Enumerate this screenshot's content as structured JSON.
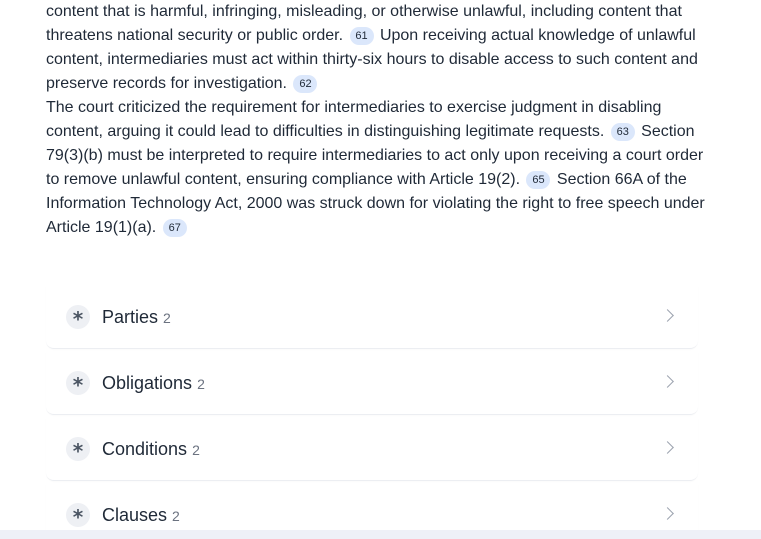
{
  "paragraphs": [
    {
      "segments": [
        {
          "type": "text",
          "value": "content that is harmful, infringing, misleading, or otherwise unlawful, including content that threatens national security or public order. "
        },
        {
          "type": "cite",
          "value": "61"
        },
        {
          "type": "text",
          "value": " Upon receiving actual knowledge of unlawful content, intermediaries must act within thirty-six hours to disable access to such content and preserve records for investigation. "
        },
        {
          "type": "cite",
          "value": "62"
        }
      ]
    },
    {
      "segments": [
        {
          "type": "text",
          "value": "The court criticized the requirement for intermediaries to exercise judgment in disabling content, arguing it could lead to difficulties in distinguishing legitimate requests. "
        },
        {
          "type": "cite",
          "value": "63"
        },
        {
          "type": "text",
          "value": " Section 79(3)(b) must be interpreted to require intermediaries to act only upon receiving a court order to remove unlawful content, ensuring compliance with Article 19(2). "
        },
        {
          "type": "cite",
          "value": "65"
        },
        {
          "type": "text",
          "value": " Section 66A of the Information Technology Act, 2000 was struck down for violating the right to free speech under Article 19(1)(a). "
        },
        {
          "type": "cite",
          "value": "67"
        }
      ]
    }
  ],
  "sections": [
    {
      "title": "Parties",
      "count": "2"
    },
    {
      "title": "Obligations",
      "count": "2"
    },
    {
      "title": "Conditions",
      "count": "2"
    },
    {
      "title": "Clauses",
      "count": "2"
    }
  ],
  "icons": {
    "section_icon": "asterisk-icon",
    "section_chevron": "chevron-right-icon"
  },
  "colors": {
    "citation_badge": "#dbe7fb",
    "text": "#1f2937",
    "muted": "#6b7280"
  }
}
